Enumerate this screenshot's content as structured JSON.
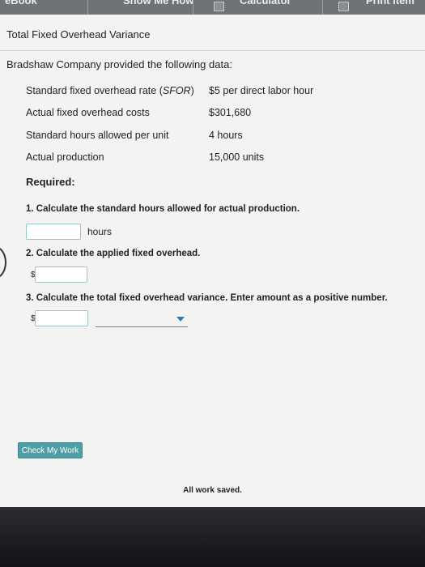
{
  "toolbar": {
    "ebook": "eBook",
    "show_me_how": "Show Me How",
    "calculator": "Calculator",
    "print_item": "Print Item"
  },
  "title": "Total Fixed Overhead Variance",
  "intro": "Bradshaw Company provided the following data:",
  "data_rows": [
    {
      "label": "Standard fixed overhead rate (SFOR)",
      "value": "$5 per direct labor hour"
    },
    {
      "label": "Actual fixed overhead costs",
      "value": "$301,680"
    },
    {
      "label": "Standard hours allowed per unit",
      "value": "4 hours"
    },
    {
      "label": "Actual production",
      "value": "15,000 units"
    }
  ],
  "required": "Required:",
  "q1": {
    "text": "1. Calculate the standard hours allowed for actual production.",
    "unit": "hours",
    "value": ""
  },
  "q2": {
    "text": "2. Calculate the applied fixed overhead.",
    "currency": "$",
    "value": ""
  },
  "q3": {
    "text": "3. Calculate the total fixed overhead variance. Enter amount as a positive number.",
    "currency": "$",
    "value": "",
    "select_value": ""
  },
  "check_button": "Check My Work",
  "status": "All work saved."
}
